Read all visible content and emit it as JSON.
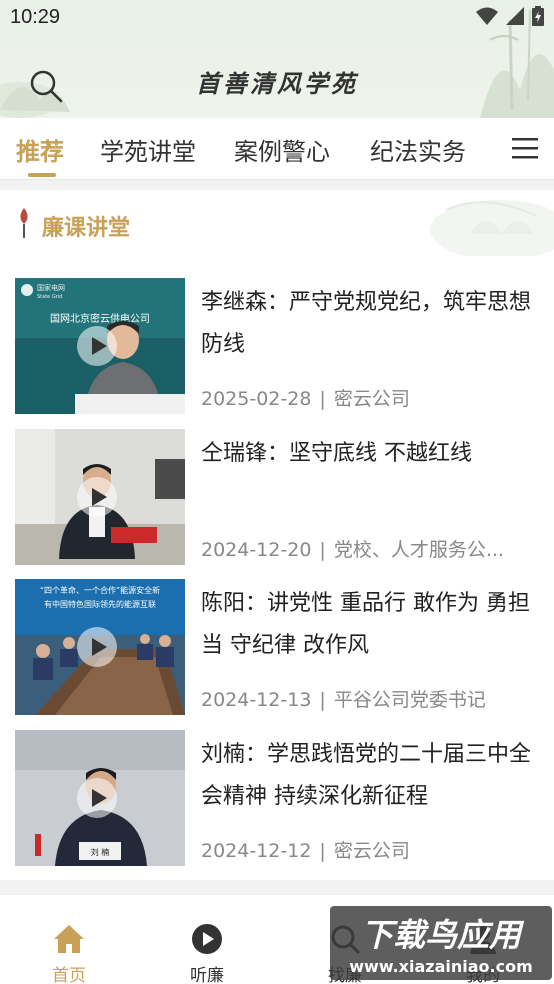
{
  "status_bar": {
    "time": "10:29"
  },
  "header": {
    "title": "首善清风学苑"
  },
  "tabs": [
    {
      "label": "推荐",
      "active": true
    },
    {
      "label": "学苑讲堂"
    },
    {
      "label": "案例警心"
    },
    {
      "label": "纪法实务"
    }
  ],
  "section": {
    "title": "廉课讲堂"
  },
  "news": [
    {
      "title": "李继森：严守党规党纪，筑牢思想防线",
      "date": "2025-02-28",
      "source": "密云公司",
      "thumb_logo": "国家电网",
      "thumb_logo_en": "State Grid",
      "thumb_caption": "国网北京密云供电公司"
    },
    {
      "title": "仝瑞锋：坚守底线 不越红线",
      "date": "2024-12-20",
      "source": "党校、人才服务公..."
    },
    {
      "title": "陈阳：讲党性 重品行 敢作为 勇担当 守纪律 改作风",
      "date": "2024-12-13",
      "source": "平谷公司党委书记",
      "thumb_caption": "“四个革命、一个合作”能源安全新",
      "thumb_caption2": "有中国特色国际领先的能源互联"
    },
    {
      "title": "刘楠：学思践悟党的二十届三中全会精神 持续深化新征程",
      "date": "2024-12-12",
      "source": "密云公司",
      "thumb_caption": "刘 楠"
    }
  ],
  "bottom_nav": [
    {
      "label": "首页",
      "icon": "home-icon",
      "active": true
    },
    {
      "label": "听廉",
      "icon": "play-circle-icon"
    },
    {
      "label": "找廉",
      "icon": "search-icon"
    },
    {
      "label": "我的",
      "icon": "user-icon"
    }
  ],
  "watermark": {
    "title": "下载鸟应用",
    "url": "www.xiazainiao.com"
  },
  "colors": {
    "accent": "#c8a058",
    "header_bg": "#e9f0e7"
  }
}
